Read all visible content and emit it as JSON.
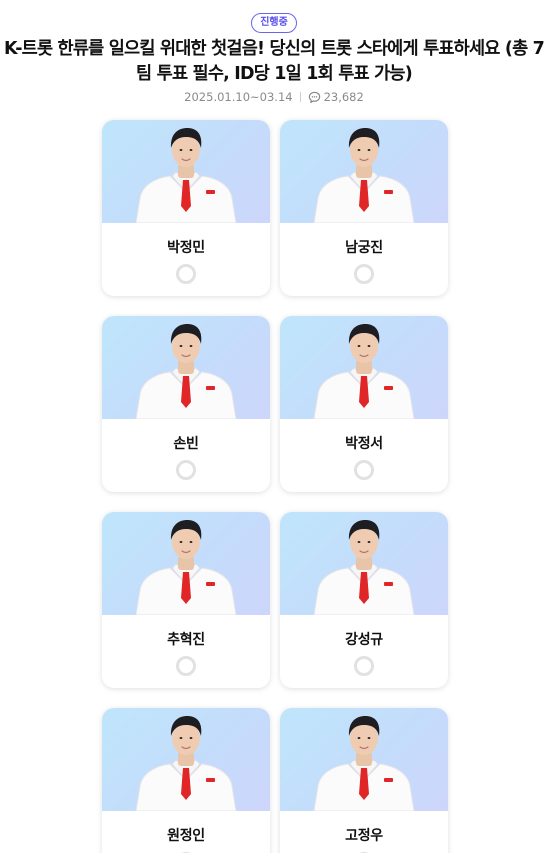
{
  "status": "진행중",
  "title": "K-트롯 한류를 일으킬 위대한 첫걸음! 당신의 트롯 스타에게 투표하세요 (총 7팀 투표 필수, ID당 1일 1회 투표 가능)",
  "period": "2025.01.10~03.14",
  "comment_count": "23,682",
  "candidates": [
    {
      "name": "박정민"
    },
    {
      "name": "남궁진"
    },
    {
      "name": "손빈"
    },
    {
      "name": "박정서"
    },
    {
      "name": "추혁진"
    },
    {
      "name": "강성규"
    },
    {
      "name": "원정인"
    },
    {
      "name": "고정우"
    }
  ],
  "colors": {
    "accent": "#5a50ee",
    "card_bg_top": "#bfe6fb",
    "card_bg_bottom": "#cdd6fb",
    "radio_border": "#e1e1e1",
    "suit": "#fbfbfb",
    "tie": "#e02626"
  }
}
